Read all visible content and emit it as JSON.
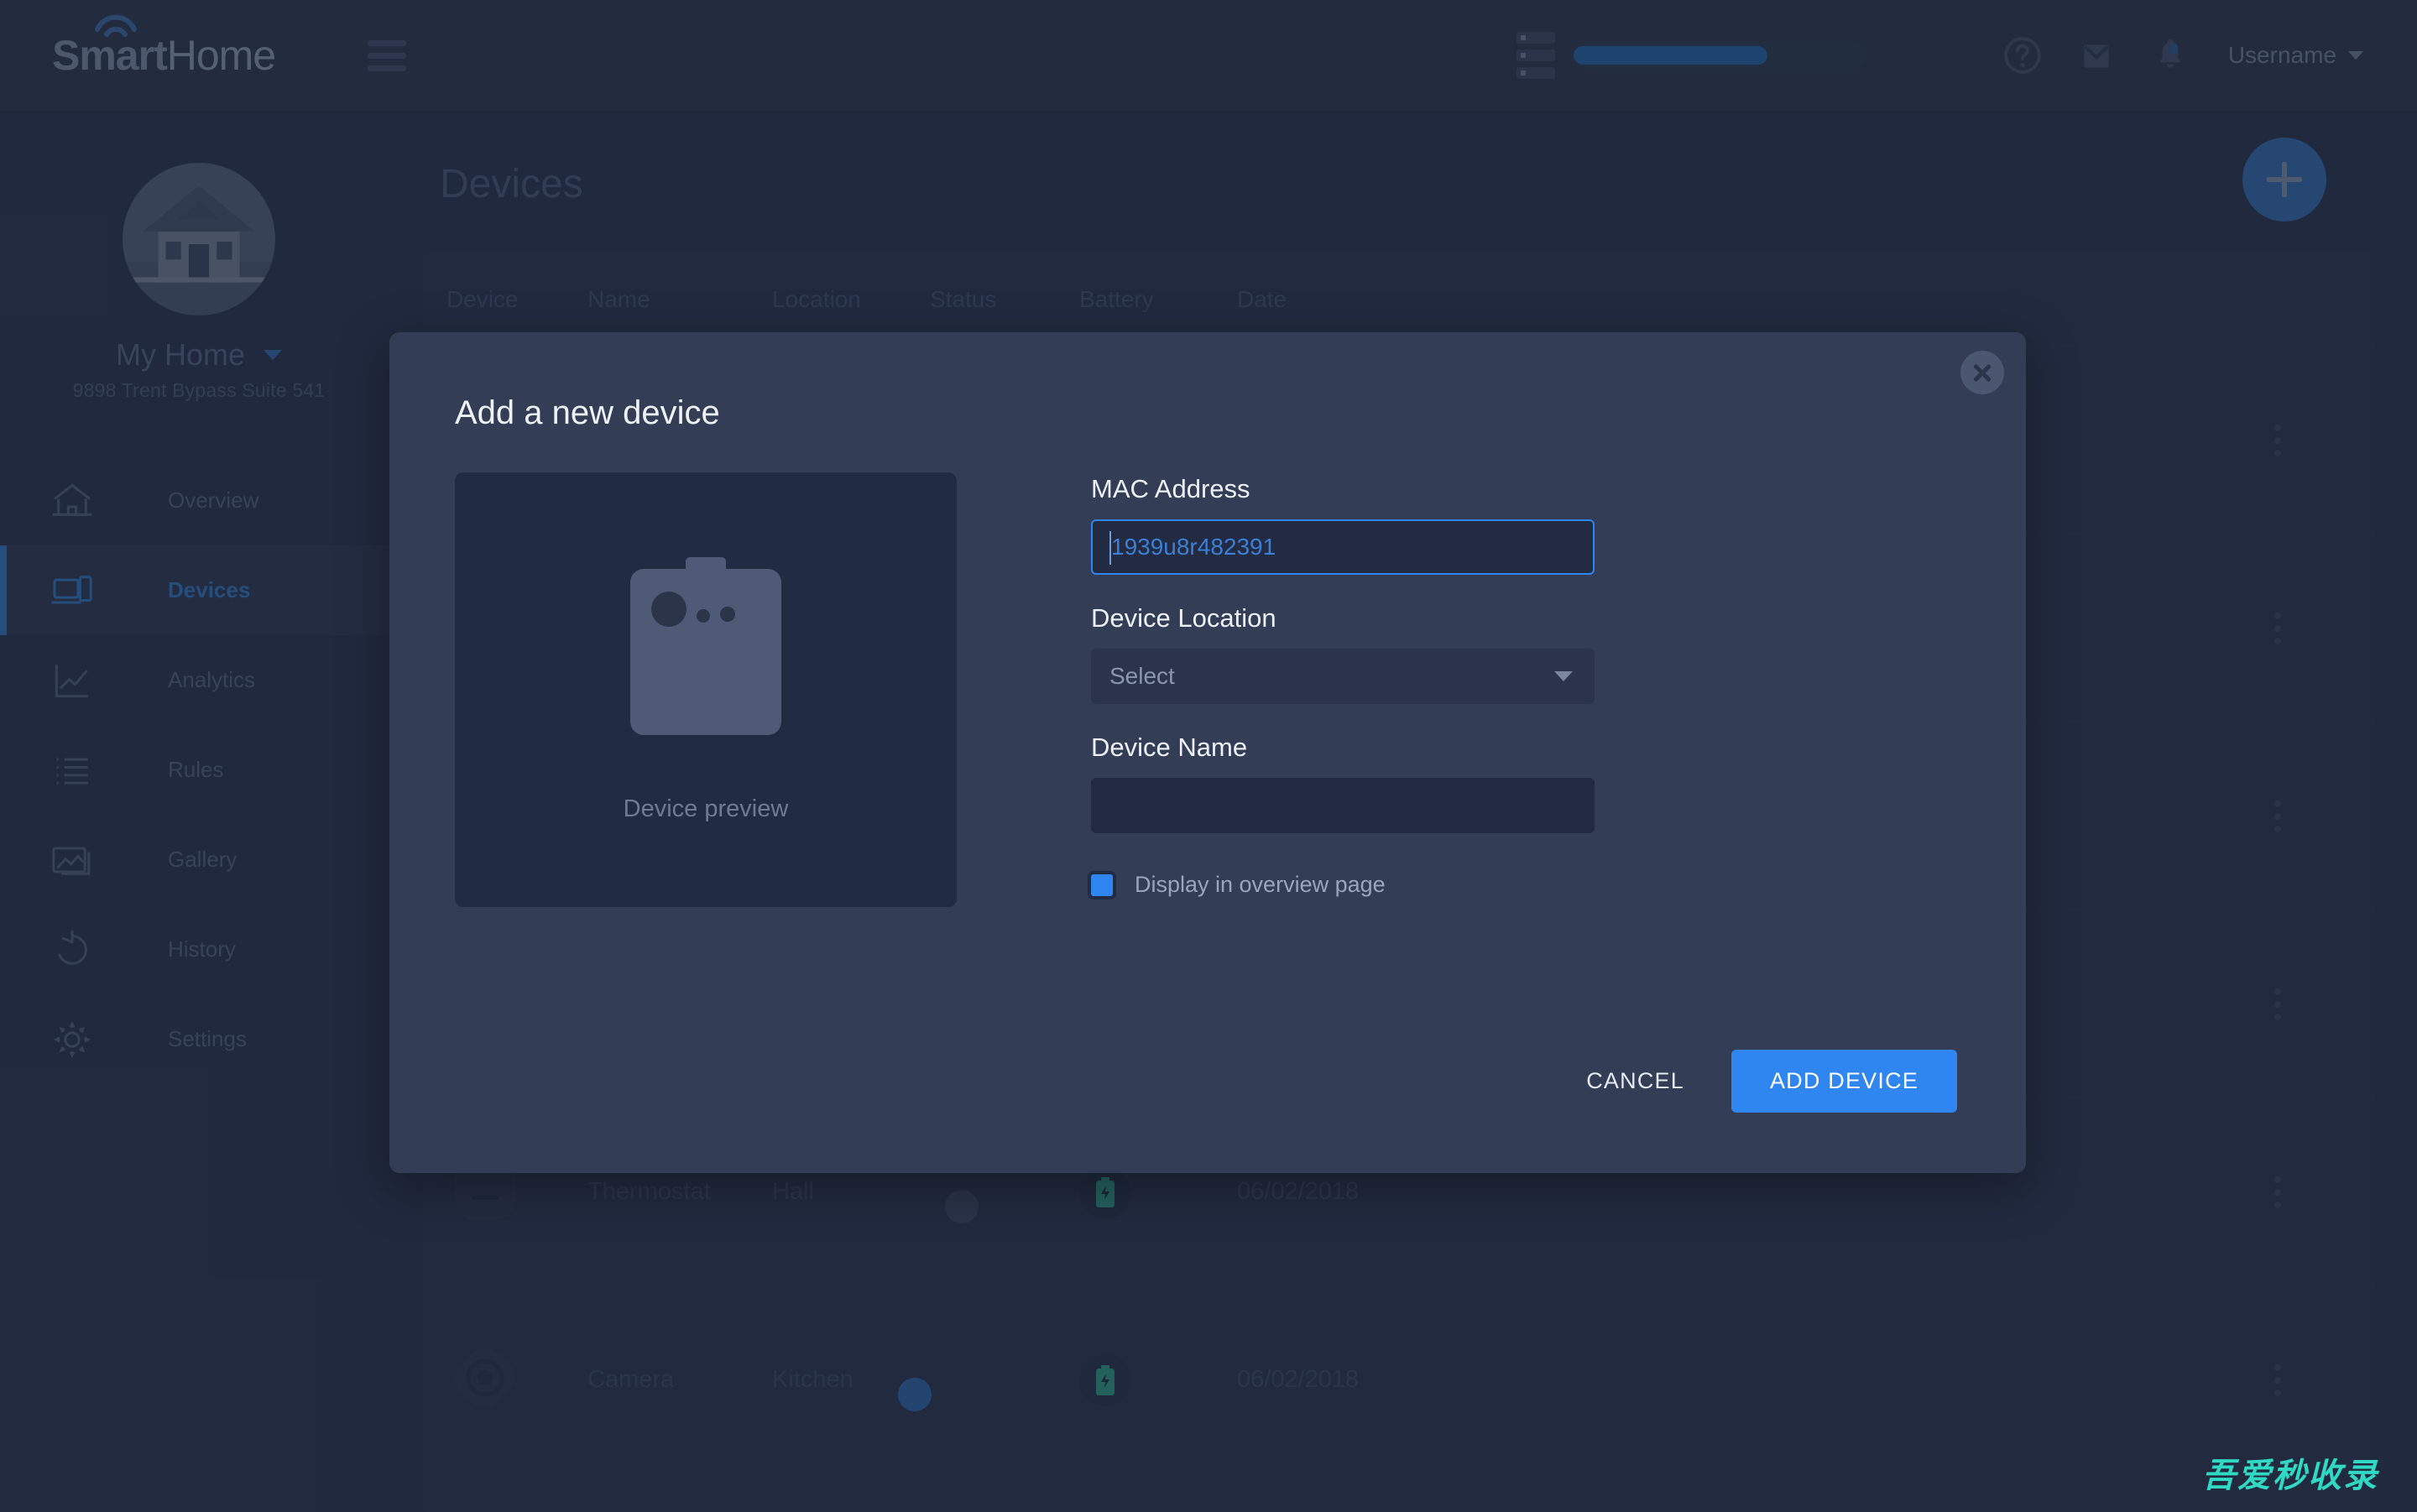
{
  "brand": {
    "name_bold": "Smart",
    "name_light": "Home"
  },
  "header": {
    "menu_icon": "hamburger-icon",
    "storage_icon": "storage-list-icon",
    "progress_percent": 66,
    "help_icon": "help-circle-icon",
    "mail_icon": "mail-icon",
    "bell_icon": "bell-notification-icon",
    "username": "Username",
    "user_caret": "chevron-down-icon"
  },
  "sidebar": {
    "home_name": "My Home",
    "home_address": "9898 Trent Bypass Suite 541",
    "avatar_icon": "house-photo",
    "items": [
      {
        "label": "Overview",
        "icon": "house-icon",
        "active": false
      },
      {
        "label": "Devices",
        "icon": "devices-icon",
        "active": true
      },
      {
        "label": "Analytics",
        "icon": "chart-icon",
        "active": false
      },
      {
        "label": "Rules",
        "icon": "list-icon",
        "active": false
      },
      {
        "label": "Gallery",
        "icon": "image-icon",
        "active": false
      },
      {
        "label": "History",
        "icon": "undo-icon",
        "active": false
      },
      {
        "label": "Settings",
        "icon": "gear-icon",
        "active": false
      }
    ]
  },
  "main": {
    "page_title": "Devices",
    "add_button_icon": "plus-icon",
    "table": {
      "columns": [
        "Device",
        "Name",
        "Location",
        "Status",
        "Battery",
        "Date"
      ],
      "rows": [
        {
          "name": "",
          "location": "",
          "date": "",
          "status": "off",
          "battery": "",
          "icon": "",
          "hidden": true
        },
        {
          "name": "",
          "location": "",
          "date": "",
          "status": "off",
          "battery": "",
          "icon": "",
          "hidden": true
        },
        {
          "name": "",
          "location": "",
          "date": "",
          "status": "off",
          "battery": "",
          "icon": "",
          "hidden": true
        },
        {
          "name": "",
          "location": "",
          "date": "",
          "status": "off",
          "battery": "",
          "icon": "",
          "hidden": true
        },
        {
          "name": "Thermostat",
          "location": "Hall",
          "date": "06/02/2018",
          "status": "off",
          "battery": "charging",
          "icon": "thermostat-icon",
          "hidden": false
        },
        {
          "name": "Camera",
          "location": "Kitchen",
          "date": "06/02/2018",
          "status": "on",
          "battery": "charging",
          "icon": "camera-icon",
          "hidden": false
        }
      ]
    }
  },
  "modal": {
    "title": "Add a new device",
    "close_icon": "close-icon",
    "preview_label": "Device preview",
    "preview_icon": "camera-device-illustration",
    "mac_label": "MAC Address",
    "mac_value": "1939u8r482391",
    "mac_valid_icon": "check-icon",
    "location_label": "Device Location",
    "location_value": "Select",
    "location_caret": "chevron-down-icon",
    "name_label": "Device Name",
    "name_value": "",
    "checkbox_label": "Display in overview page",
    "checkbox_checked": true,
    "cancel_label": "CANCEL",
    "submit_label": "ADD DEVICE"
  },
  "watermark": {
    "text": "吾爱秒收录"
  },
  "colors": {
    "accent": "#2f86f0",
    "accent_dark": "#2f6fb5",
    "page_bg": "#252e45",
    "modal_bg": "#333e56",
    "success": "#2ad98b",
    "battery": "#2ea98a"
  }
}
